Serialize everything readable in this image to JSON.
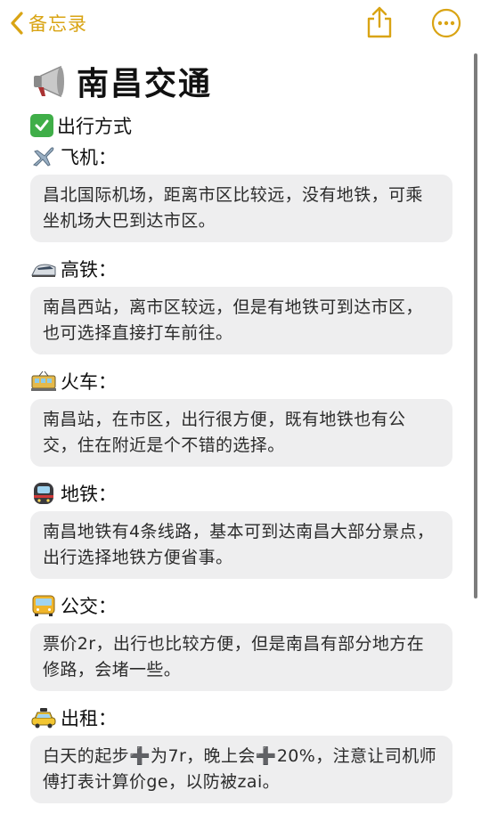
{
  "nav": {
    "back_label": "备忘录",
    "share_icon": "share-icon",
    "more_icon": "more-ellipsis-icon"
  },
  "note": {
    "title": "南昌交通",
    "title_icon": "megaphone-icon",
    "subtitle": "出行方式",
    "subtitle_icon": "check-mark-icon",
    "sections": [
      {
        "label": "飞机：",
        "icon": "airplane-icon",
        "text": "昌北国际机场，距离市区比较远，没有地铁，可乘坐机场大巴到达市区。"
      },
      {
        "label": "高铁：",
        "icon": "bullet-train-icon",
        "text": "南昌西站，离市区较远，但是有地铁可到达市区，也可选择直接打车前往。"
      },
      {
        "label": "火车：",
        "icon": "tram-icon",
        "text": "南昌站，在市区，出行很方便，既有地铁也有公交，住在附近是个不错的选择。"
      },
      {
        "label": "地铁：",
        "icon": "metro-icon",
        "text": "南昌地铁有4条线路，基本可到达南昌大部分景点，出行选择地铁方便省事。"
      },
      {
        "label": "公交：",
        "icon": "bus-icon",
        "text": "票价2r，出行也比较方便，但是南昌有部分地方在修路，会堵一些。"
      },
      {
        "label": "出租：",
        "icon": "taxi-icon",
        "text": "白天的起步➕为7r，晚上会➕20%，注意让司机师傅打表计算价ge，以防被zai。"
      }
    ]
  },
  "colors": {
    "accent": "#d9a414",
    "card_bg": "#eeeeef",
    "check_green": "#3fae48"
  }
}
